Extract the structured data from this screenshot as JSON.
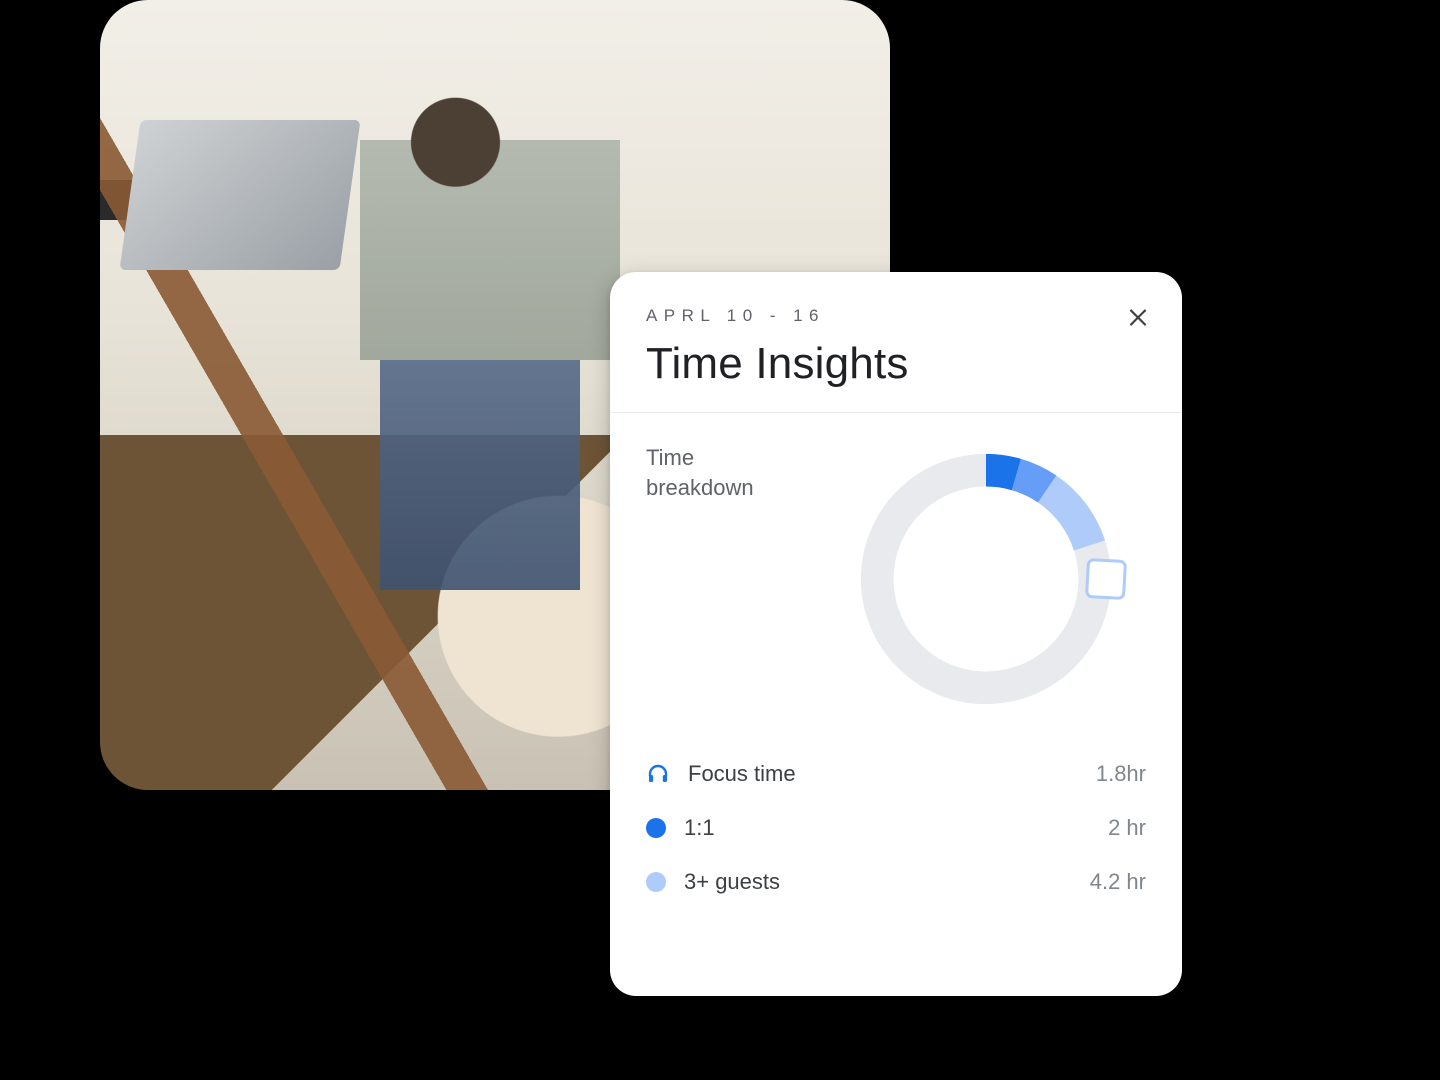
{
  "card": {
    "date_range": "APRL 10 - 16",
    "title": "Time Insights",
    "breakdown_label": "Time breakdown",
    "legend": [
      {
        "icon": "headphones",
        "color": "#1a73e8",
        "label": "Focus time",
        "value": "1.8hr",
        "hours": 1.8
      },
      {
        "icon": "dot",
        "color": "#1a73e8",
        "label": "1:1",
        "value": "2 hr",
        "hours": 2.0
      },
      {
        "icon": "dot",
        "color": "#aecbfa",
        "label": "3+ guests",
        "value": "4.2 hr",
        "hours": 4.2
      }
    ],
    "close_label": "Close"
  },
  "chart_data": {
    "type": "pie",
    "title": "Time breakdown",
    "note": "Donut shows categorized hours as arc segments; the remainder of the ring is unclassified/empty time shown in light grey.",
    "series": [
      {
        "name": "Focus time",
        "value": 1.8,
        "color": "#1a73e8"
      },
      {
        "name": "1:1",
        "value": 2.0,
        "color": "#669df6"
      },
      {
        "name": "3+ guests",
        "value": 4.2,
        "color": "#aecbfa"
      }
    ],
    "remainder_color": "#e8eaed",
    "total_ring_hours_estimate": 40
  },
  "colors": {
    "text_primary": "#202124",
    "text_secondary": "#5f6368",
    "text_muted": "#80868b",
    "divider": "#e8eaed",
    "blue_700": "#1a73e8",
    "blue_400": "#669df6",
    "blue_200": "#aecbfa"
  }
}
